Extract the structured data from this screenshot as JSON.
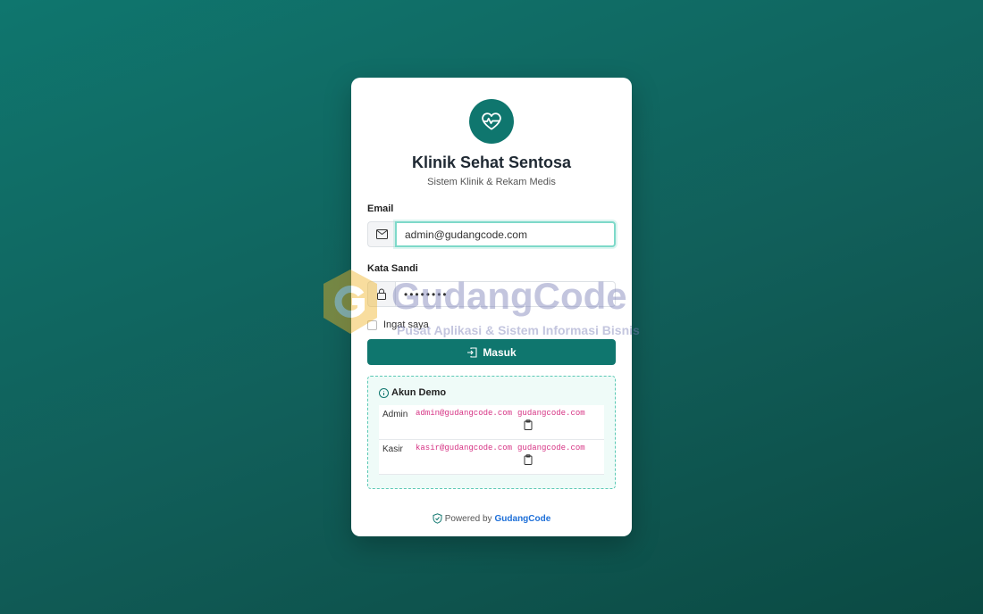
{
  "app": {
    "title": "Klinik Sehat Sentosa",
    "subtitle": "Sistem Klinik & Rekam Medis"
  },
  "form": {
    "email_label": "Email",
    "email_value": "admin@gudangcode.com",
    "password_label": "Kata Sandi",
    "password_value": "••••••••",
    "remember_label": "Ingat saya",
    "submit_label": "Masuk"
  },
  "demo": {
    "heading": "Akun Demo",
    "accounts": [
      {
        "role": "Admin",
        "email": "admin@gudangcode.com",
        "password": "gudangcode.com"
      },
      {
        "role": "Kasir",
        "email": "kasir@gudangcode.com",
        "password": "gudangcode.com"
      }
    ]
  },
  "footer": {
    "prefix": "Powered by",
    "brand": "GudangCode"
  },
  "watermark": {
    "title": "GudangCode",
    "tagline": "Pusat Aplikasi & Sistem Informasi Bisnis"
  },
  "colors": {
    "primary": "#0f766e",
    "link": "#1d6fd8",
    "code": "#d63384"
  },
  "icons": [
    "heart-pulse-icon",
    "envelope-icon",
    "lock-icon",
    "login-icon",
    "info-icon",
    "clipboard-icon",
    "shield-check-icon"
  ]
}
